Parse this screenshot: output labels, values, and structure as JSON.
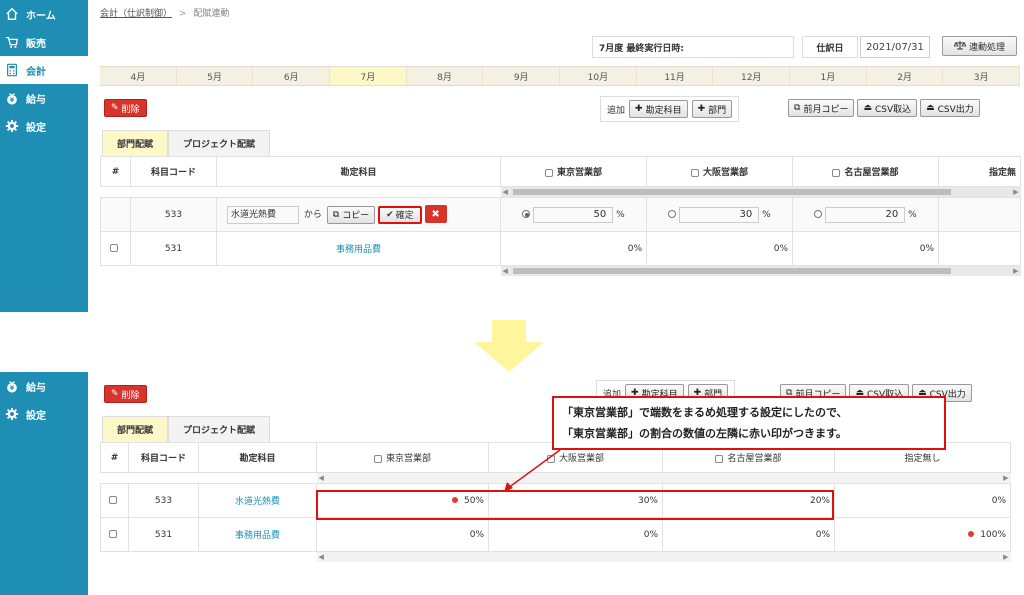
{
  "sidebar_top": {
    "items": [
      {
        "label": "ホーム",
        "icon": "home-icon",
        "active": false
      },
      {
        "label": "販売",
        "icon": "cart-icon",
        "active": false
      },
      {
        "label": "会計",
        "icon": "calculator-icon",
        "active": true
      },
      {
        "label": "給与",
        "icon": "money-bag-icon",
        "active": false
      },
      {
        "label": "設定",
        "icon": "gear-icon",
        "active": false
      }
    ]
  },
  "sidebar_bottom": {
    "items": [
      {
        "label": "給与",
        "icon": "money-bag-icon"
      },
      {
        "label": "設定",
        "icon": "gear-icon"
      }
    ]
  },
  "breadcrumb": {
    "parent": "会計（仕訳制御）",
    "separator": ">",
    "current": "配賦連動"
  },
  "header": {
    "exec_label": "7月度 最終実行日時:",
    "date_label": "仕訳日",
    "date_value": "2021/07/31",
    "sync_button": "連動処理"
  },
  "months": [
    "4月",
    "5月",
    "6月",
    "7月",
    "8月",
    "9月",
    "10月",
    "11月",
    "12月",
    "1月",
    "2月",
    "3月"
  ],
  "active_month": "7月",
  "toolbar": {
    "delete_button": "削除",
    "add_label": "追加",
    "add_account_button": "勘定科目",
    "add_department_button": "部門",
    "prev_month_copy_button": "前月コピー",
    "csv_import_button": "CSV取込",
    "csv_export_button": "CSV出力"
  },
  "tabs": [
    "部門配賦",
    "プロジェクト配賦"
  ],
  "table": {
    "headers": {
      "num": "#",
      "code": "科目コード",
      "account": "勘定科目",
      "dept1": "東京営業部",
      "dept2": "大阪営業部",
      "dept3": "名古屋営業部",
      "none": "指定無し"
    },
    "header_none_truncated": "指定無",
    "top_rows": [
      {
        "code": "533",
        "name": "水道光熱費",
        "from_label": "から",
        "copy_button": "コピー",
        "confirm_button": "確定",
        "v1": "50",
        "v2": "30",
        "v3": "20",
        "unit": "%"
      },
      {
        "code": "531",
        "name": "事務用品費",
        "v1": "0%",
        "v2": "0%",
        "v3": "0%"
      }
    ],
    "bottom_rows": [
      {
        "code": "533",
        "name": "水道光熱費",
        "v1": "50%",
        "v2": "30%",
        "v3": "20%",
        "v4": "0%"
      },
      {
        "code": "531",
        "name": "事務用品費",
        "v1": "0%",
        "v2": "0%",
        "v3": "0%",
        "v4": "100%"
      }
    ]
  },
  "callout": {
    "line1": "「東京営業部」で端数をまるめ処理する設定にしたので、",
    "line2": "「東京営業部」の割合の数値の左隣に赤い印がつきます。"
  },
  "colors": {
    "sidebar": "#1e8eb4",
    "accent_red": "#d9342b",
    "highlight": "#fcf8c8",
    "arrow": "#fff59d"
  }
}
